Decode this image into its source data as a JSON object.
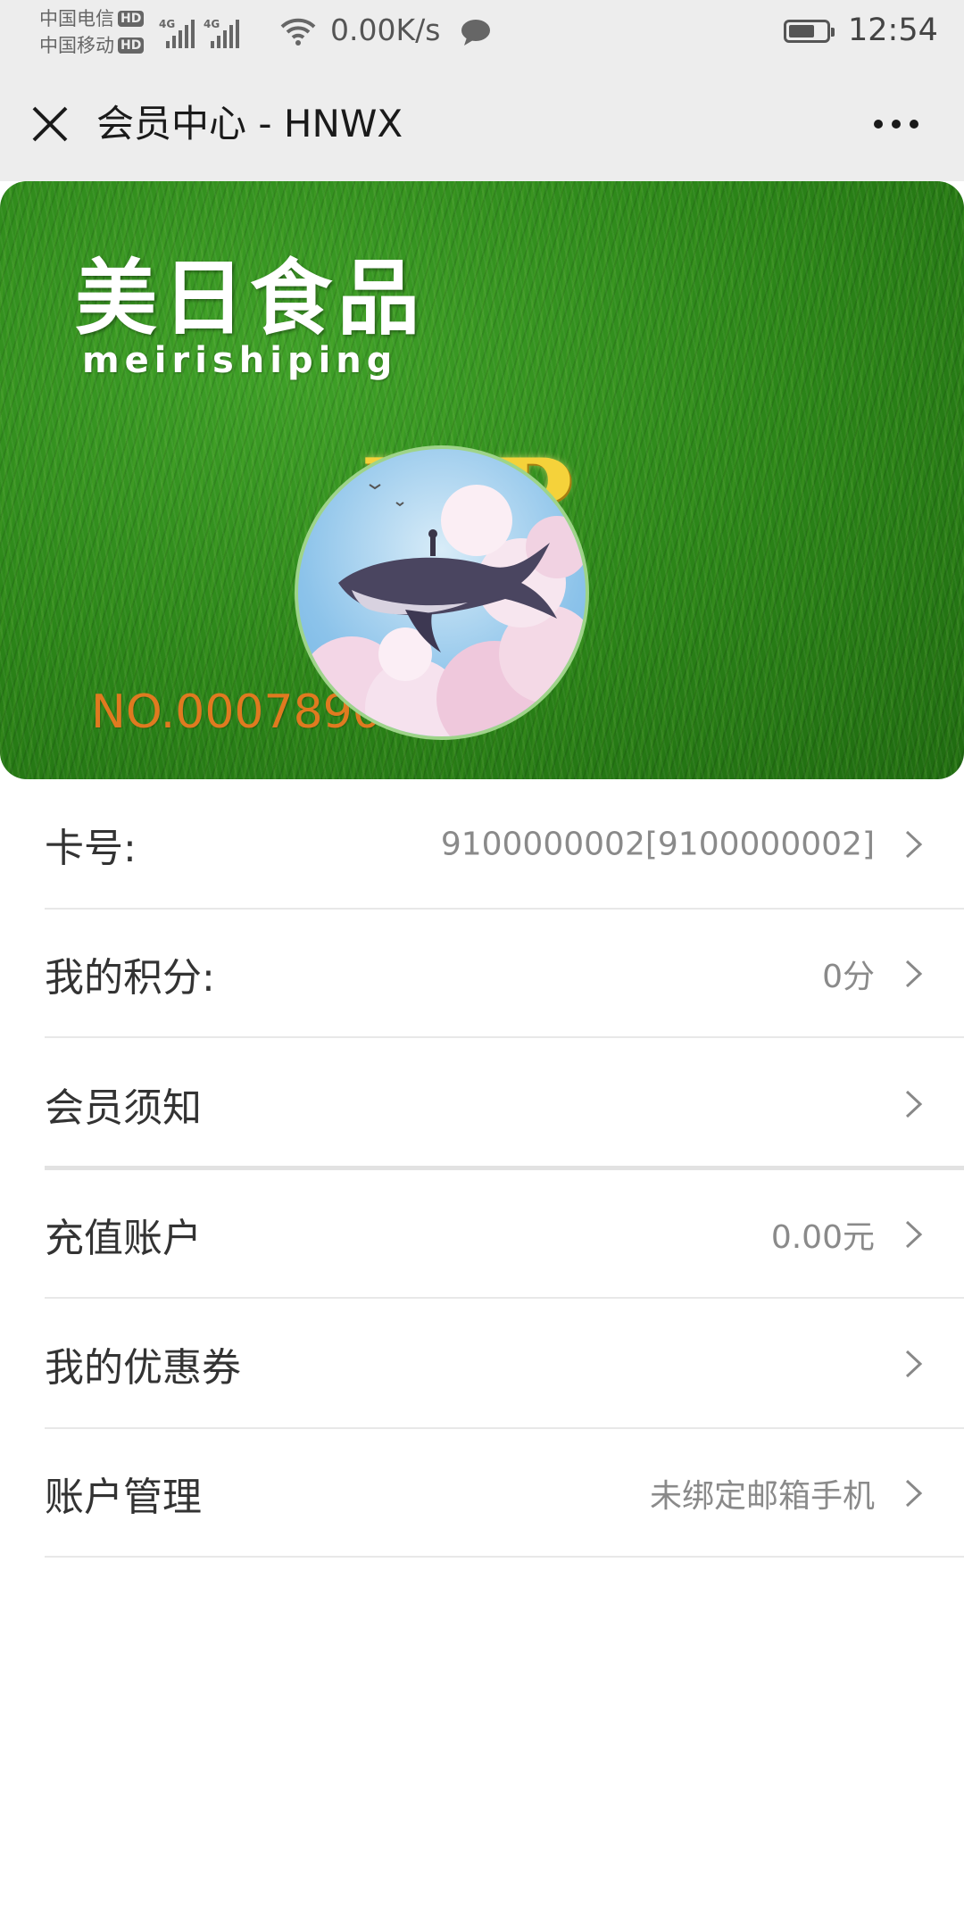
{
  "status_bar": {
    "carrier1": "中国电信",
    "carrier2": "中国移动",
    "hd_label": "HD",
    "network_tag": "4G",
    "net_speed": "0.00K/s",
    "time": "12:54"
  },
  "title_bar": {
    "title": "会员中心 - HNWX",
    "close_icon": "close-icon",
    "more_icon": "more-icon"
  },
  "card": {
    "brand_name": "美日食品",
    "brand_pinyin": "meirishiping",
    "vip_text": "VIP",
    "card_number": "NO.0007890",
    "colors": {
      "grass": "#2e8a1a",
      "gold": "#f5d23a",
      "number": "#e07a20"
    }
  },
  "menu": [
    {
      "label": "卡号:",
      "value": "9100000002[9100000002]"
    },
    {
      "label": "我的积分:",
      "value": "0分"
    },
    {
      "label": "会员须知",
      "value": ""
    },
    {
      "label": "充值账户",
      "value": "0.00元"
    },
    {
      "label": "我的优惠券",
      "value": ""
    },
    {
      "label": "账户管理",
      "value": "未绑定邮箱手机"
    }
  ]
}
